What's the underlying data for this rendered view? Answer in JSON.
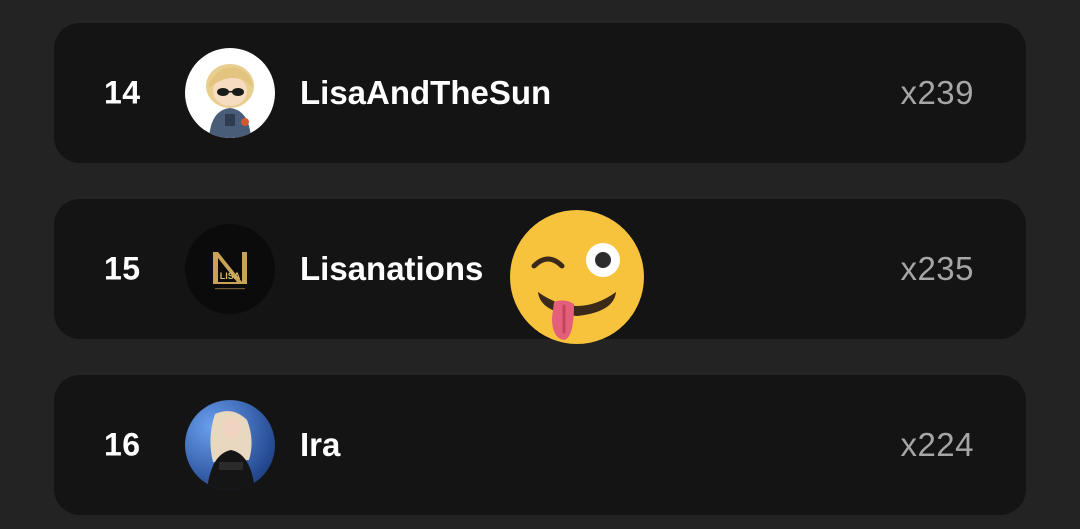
{
  "leaderboard": {
    "rows": [
      {
        "rank": "14",
        "name": "LisaAndTheSun",
        "count": "x239",
        "avatar_icon": "cartoon-girl-avatar"
      },
      {
        "rank": "15",
        "name": "Lisanations",
        "count": "x235",
        "avatar_icon": "lisa-logo-avatar",
        "avatar_text": "LISA"
      },
      {
        "rank": "16",
        "name": "Ira",
        "count": "x224",
        "avatar_icon": "photo-avatar"
      }
    ]
  },
  "overlay": {
    "reaction_icon": "winking-tongue-emoji"
  },
  "colors": {
    "background": "#232323",
    "card": "#141414",
    "text_primary": "#ffffff",
    "text_muted": "#a6a6a6",
    "logo_gold": "#c9a25a"
  }
}
